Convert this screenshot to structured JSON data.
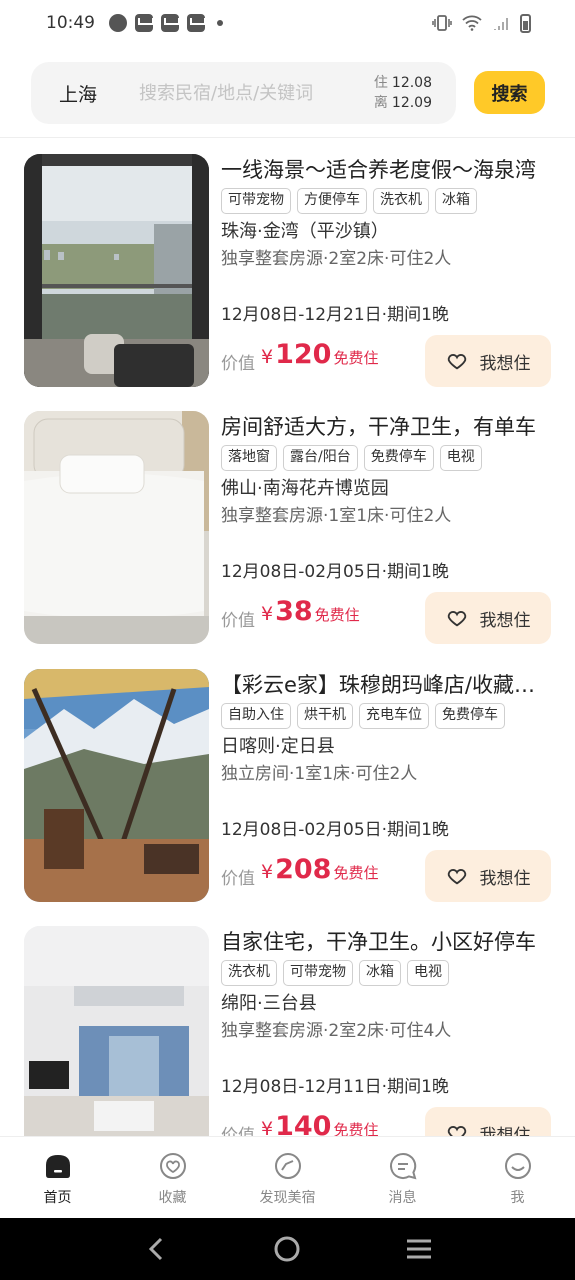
{
  "status_bar": {
    "time": "10:49"
  },
  "search": {
    "city": "上海",
    "placeholder": "搜索民宿/地点/关键词",
    "checkin_label": "住",
    "checkin_date": "12.08",
    "checkout_label": "离",
    "checkout_date": "12.09",
    "button_label": "搜索"
  },
  "listings": [
    {
      "title": "一线海景～适合养老度假～海泉湾",
      "tags": [
        "可带宠物",
        "方便停车",
        "洗衣机",
        "冰箱"
      ],
      "location": "珠海·金湾（平沙镇）",
      "details": "独享整套房源·2室2床·可住2人",
      "period": "12月08日-12月21日·期间1晚",
      "price_label": "价值",
      "currency": "¥",
      "price": "120",
      "free_label": "免费住",
      "want_label": "我想住"
    },
    {
      "title": "房间舒适大方，干净卫生，有单车",
      "tags": [
        "落地窗",
        "露台/阳台",
        "免费停车",
        "电视"
      ],
      "location": "佛山·南海花卉博览园",
      "details": "独享整套房源·1室1床·可住2人",
      "period": "12月08日-02月05日·期间1晚",
      "price_label": "价值",
      "currency": "¥",
      "price": "38",
      "free_label": "免费住",
      "want_label": "我想住"
    },
    {
      "title": "【彩云e家】珠穆朗玛峰店/收藏自在",
      "tags": [
        "自助入住",
        "烘干机",
        "充电车位",
        "免费停车"
      ],
      "location": "日喀则·定日县",
      "details": "独立房间·1室1床·可住2人",
      "period": "12月08日-02月05日·期间1晚",
      "price_label": "价值",
      "currency": "¥",
      "price": "208",
      "free_label": "免费住",
      "want_label": "我想住"
    },
    {
      "title": "自家住宅，干净卫生。小区好停车",
      "tags": [
        "洗衣机",
        "可带宠物",
        "冰箱",
        "电视"
      ],
      "location": "绵阳·三台县",
      "details": "独享整套房源·2室2床·可住4人",
      "period": "12月08日-12月11日·期间1晚",
      "price_label": "价值",
      "currency": "¥",
      "price": "140",
      "free_label": "免费住",
      "want_label": "我想住"
    }
  ],
  "bottom_nav": {
    "items": [
      {
        "label": "首页",
        "icon": "home-icon",
        "active": true
      },
      {
        "label": "收藏",
        "icon": "favorite-heart-icon",
        "active": false
      },
      {
        "label": "发现美宿",
        "icon": "discover-icon",
        "active": false
      },
      {
        "label": "消息",
        "icon": "message-icon",
        "active": false
      },
      {
        "label": "我",
        "icon": "profile-smile-icon",
        "active": false
      }
    ]
  },
  "colors": {
    "accent": "#ffc928",
    "price": "#e0294a",
    "want_bg": "#fdeede"
  }
}
